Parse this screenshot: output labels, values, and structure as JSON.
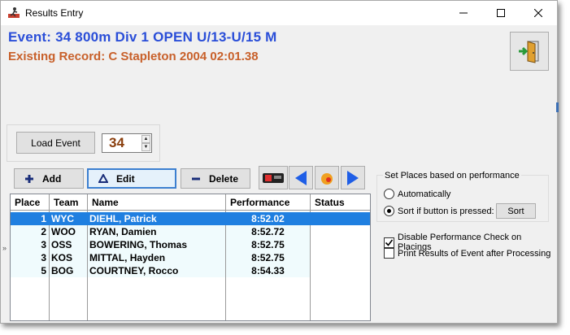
{
  "window": {
    "title": "Results Entry"
  },
  "event": {
    "title": "Event: 34  800m Div 1  OPEN U/13-U/15  M",
    "record": "Existing Record: C Stapleton 2004 02:01.38"
  },
  "load": {
    "button_label": "Load Event",
    "event_number": "34"
  },
  "toolbar": {
    "add_label": "Add",
    "edit_label": "Edit",
    "delete_label": "Delete"
  },
  "grid": {
    "columns": [
      "Place",
      "Team",
      "Name",
      "Performance",
      "Status"
    ],
    "rows": [
      {
        "place": "1",
        "team": "WYC",
        "name": "DIEHL, Patrick",
        "performance": "8:52.02",
        "status": ""
      },
      {
        "place": "2",
        "team": "WOO",
        "name": "RYAN, Damien",
        "performance": "8:52.72",
        "status": ""
      },
      {
        "place": "3",
        "team": "OSS",
        "name": "BOWERING, Thomas",
        "performance": "8:52.75",
        "status": ""
      },
      {
        "place": "3",
        "team": "KOS",
        "name": "MITTAL, Hayden",
        "performance": "8:52.75",
        "status": ""
      },
      {
        "place": "5",
        "team": "BOG",
        "name": "COURTNEY, Rocco",
        "performance": "8:54.33",
        "status": ""
      }
    ],
    "selected_row": 0,
    "row_indicator": "»"
  },
  "places": {
    "title": "Set Places based on performance",
    "options": [
      {
        "label": "Automatically",
        "checked": false
      },
      {
        "label": "Sort if button is pressed:",
        "checked": true
      }
    ],
    "sort_label": "Sort"
  },
  "checks": [
    {
      "label": "Disable Performance Check on Placings",
      "checked": true
    },
    {
      "label": "Print Results of Event after Processing",
      "checked": false
    }
  ],
  "colors": {
    "event_title": "#2a4ed8",
    "record": "#c8602a",
    "selection": "#1f7fe0",
    "nav_arrow": "#1f5ee6"
  }
}
